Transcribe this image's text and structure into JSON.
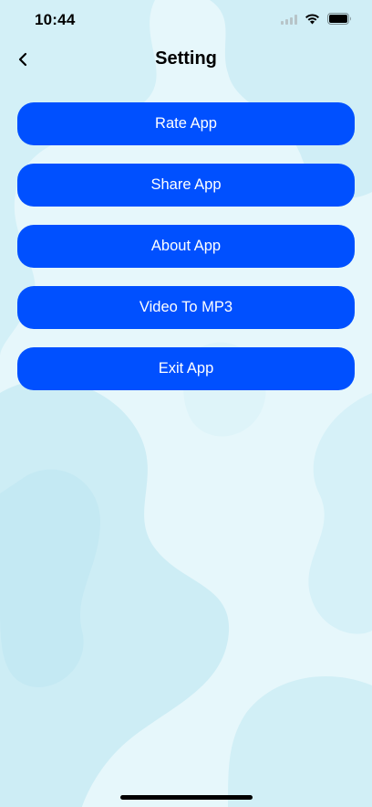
{
  "status_bar": {
    "time": "10:44",
    "icons": [
      "cellular-signal-icon",
      "wifi-icon",
      "battery-icon"
    ]
  },
  "nav": {
    "back_icon": "chevron-left-icon",
    "title": "Setting"
  },
  "menu": {
    "items": [
      {
        "label": "Rate App"
      },
      {
        "label": "Share App"
      },
      {
        "label": "About App"
      },
      {
        "label": "Video To MP3"
      },
      {
        "label": "Exit App"
      }
    ]
  },
  "colors": {
    "button_bg": "#0050ff",
    "button_text": "#ffffff",
    "background": "#e6f7fb",
    "background_blob": "#c9ecf4"
  }
}
